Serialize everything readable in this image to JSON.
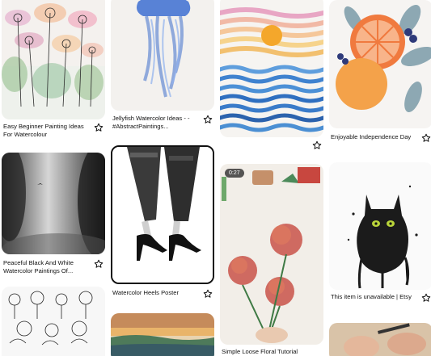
{
  "pins": [
    {
      "title": "Easy Beginner Painting Ideas For Watercolour",
      "image": "watercolor-wildflowers"
    },
    {
      "title": "Peaceful Black And White Watercolor Paintings Of...",
      "image": "misty-monochrome-landscape"
    },
    {
      "title": "",
      "image": "line-art-flowers"
    },
    {
      "title": "Jellyfish Watercolor Ideas - - #AbstractPaintings...",
      "image": "blue-jellyfish"
    },
    {
      "title": "Watercolor Heels Poster",
      "image": "ink-legs-high-heels"
    },
    {
      "title": "",
      "image": "sunset-lake-landscape"
    },
    {
      "title": "",
      "image": "sunset-over-waves"
    },
    {
      "title": "Simple Loose Floral Tutorial",
      "image": "red-chrysanthemums",
      "video_duration": "0:27"
    },
    {
      "title": "Enjoyable Independence Day",
      "image": "grapefruit-botanical"
    },
    {
      "title": "This item is unavailable | Etsy",
      "image": "ink-black-cat"
    },
    {
      "title": "",
      "image": "hands-painting"
    }
  ],
  "icons": {
    "save": "star-outline-icon"
  },
  "colors": {
    "background": "#ffffff",
    "text": "#111111"
  }
}
